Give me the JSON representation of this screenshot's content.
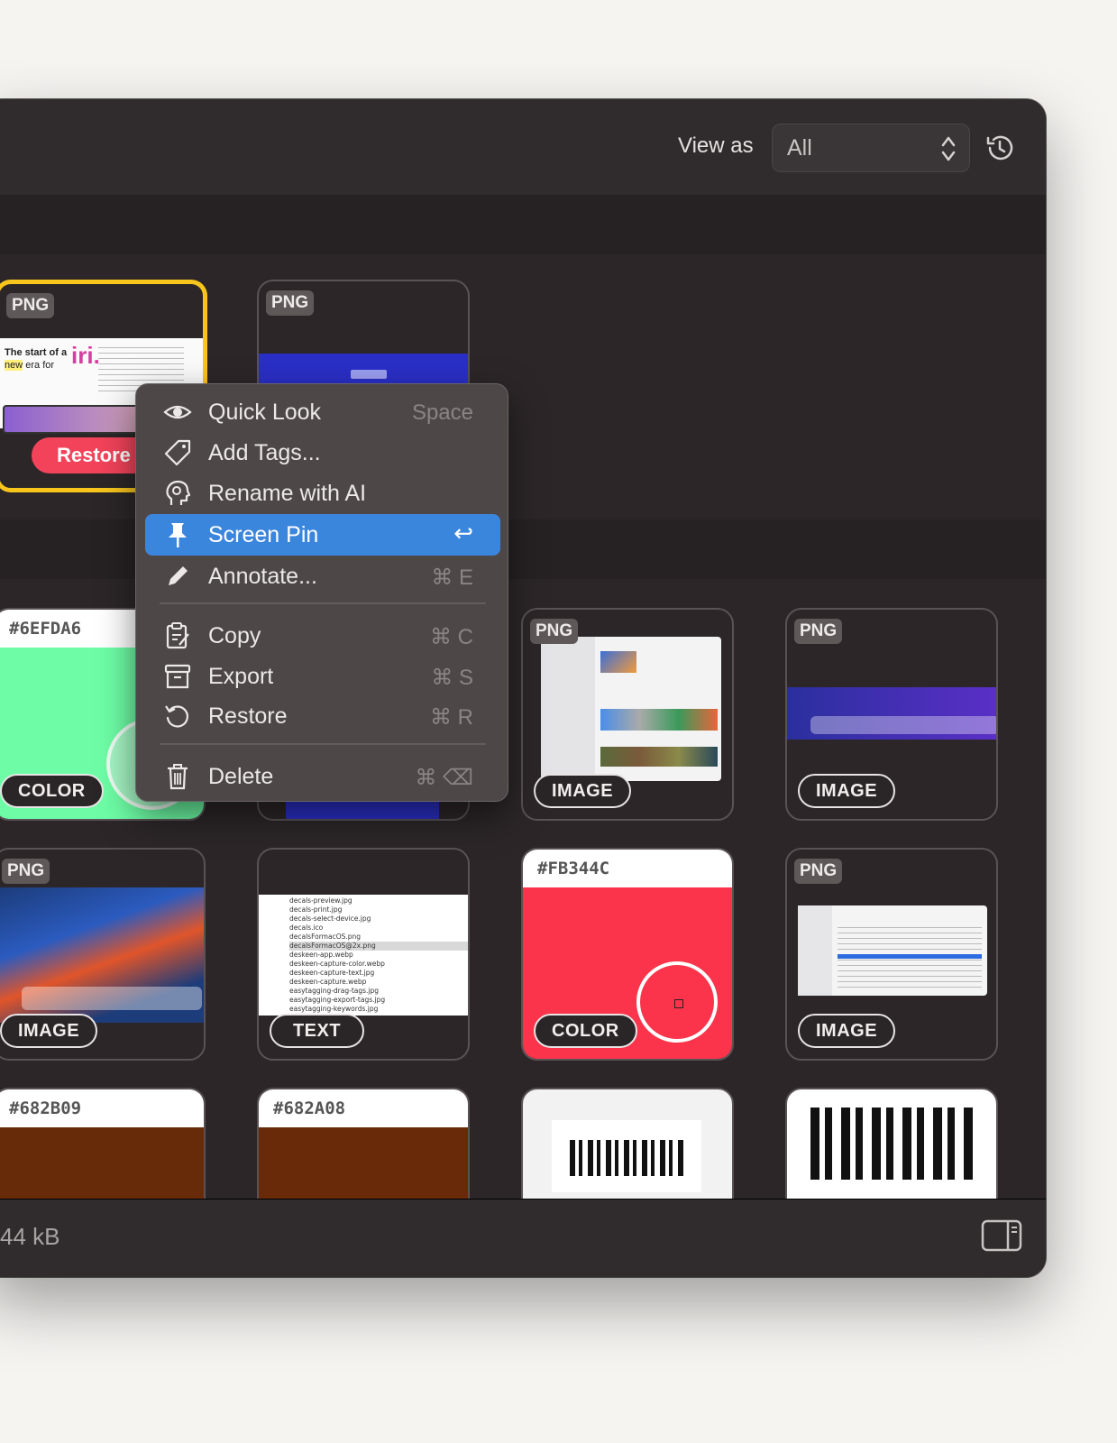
{
  "toolbar": {
    "view_as_label": "View as",
    "view_as_value": "All"
  },
  "cards": [
    {
      "badge": "PNG",
      "pill": "Restore"
    },
    {
      "badge": "PNG"
    },
    {
      "hex": "#6EFDA6",
      "pill": "COLOR",
      "color": "#6efda6"
    },
    {
      "badge": "PNG",
      "pill": "IMAGE"
    },
    {
      "badge": "PNG",
      "pill": "IMAGE"
    },
    {
      "badge": "PNG",
      "pill": "IMAGE"
    },
    {
      "pill": "TEXT",
      "files": [
        "decals-preview.jpg",
        "decals-print.jpg",
        "decals-select-device.jpg",
        "decals.ico",
        "decalsFormacOS.png",
        "decalsFormacOS@2x.png",
        "deskeen-app.webp",
        "deskeen-capture-color.webp",
        "deskeen-capture-text.jpg",
        "deskeen-capture.webp",
        "easytagging-drag-tags.jpg",
        "easytagging-export-tags.jpg",
        "easytagging-keywords.jpg"
      ]
    },
    {
      "hex": "#FB344C",
      "pill": "COLOR",
      "color": "#fb344c"
    },
    {
      "badge": "PNG",
      "pill": "IMAGE"
    },
    {
      "hex": "#682B09",
      "color": "#682b09"
    },
    {
      "hex": "#682A08",
      "color": "#682a08"
    }
  ],
  "statusbar": {
    "size": "44 kB"
  },
  "context_menu": {
    "items": [
      {
        "label": "Quick Look",
        "shortcut": "Space"
      },
      {
        "label": "Add Tags..."
      },
      {
        "label": "Rename with AI"
      },
      {
        "label": "Screen Pin",
        "shortcut": "↩",
        "highlighted": true
      },
      {
        "label": "Annotate...",
        "shortcut": "⌘ E"
      },
      {
        "label": "Copy",
        "shortcut": "⌘ C"
      },
      {
        "label": "Export",
        "shortcut": "⌘ S"
      },
      {
        "label": "Restore",
        "shortcut": "⌘ R"
      },
      {
        "label": "Delete",
        "shortcut": "⌘ ⌫"
      }
    ]
  },
  "colors": {
    "highlight": "#3b86dd",
    "selection_border": "#f7c51c",
    "restore_button": "#f2435a"
  },
  "icons": [
    "eye-icon",
    "tag-icon",
    "ai-head-icon",
    "pin-icon",
    "pencil-icon",
    "clipboard-icon",
    "archive-icon",
    "restore-icon",
    "trash-icon",
    "history-icon",
    "sidebar-icon",
    "updown-arrows-icon"
  ]
}
